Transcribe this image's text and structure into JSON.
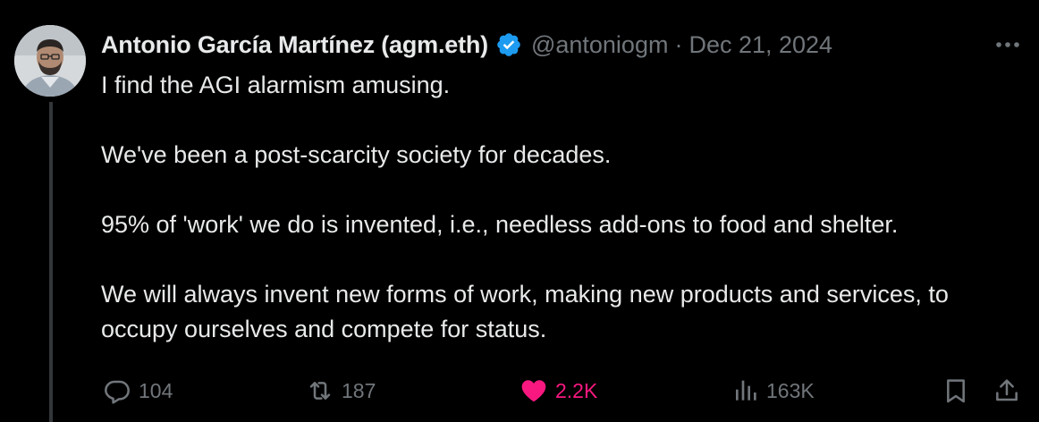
{
  "author": {
    "display_name": "Antonio García Martínez (agm.eth)",
    "handle": "@antoniogm",
    "separator": "·",
    "date": "Dec 21, 2024",
    "verified_color": "#1d9bf0"
  },
  "tweet": {
    "paragraphs": [
      "I find the AGI alarmism amusing.",
      "We've been a post-scarcity society for decades.",
      "95% of 'work' we do is invented, i.e., needless add-ons to food and shelter.",
      "We will always invent new forms of work, making new products and services, to occupy ourselves and compete for status."
    ]
  },
  "actions": {
    "replies": "104",
    "reposts": "187",
    "likes": "2.2K",
    "views": "163K",
    "liked": true,
    "like_color": "#f91880"
  },
  "icons": {
    "avatar": "avatar-photo",
    "verified": "verified-badge-icon",
    "more": "more-icon",
    "reply": "reply-icon",
    "retweet": "retweet-icon",
    "like": "heart-icon",
    "views": "views-icon",
    "bookmark": "bookmark-icon",
    "share": "share-icon"
  }
}
